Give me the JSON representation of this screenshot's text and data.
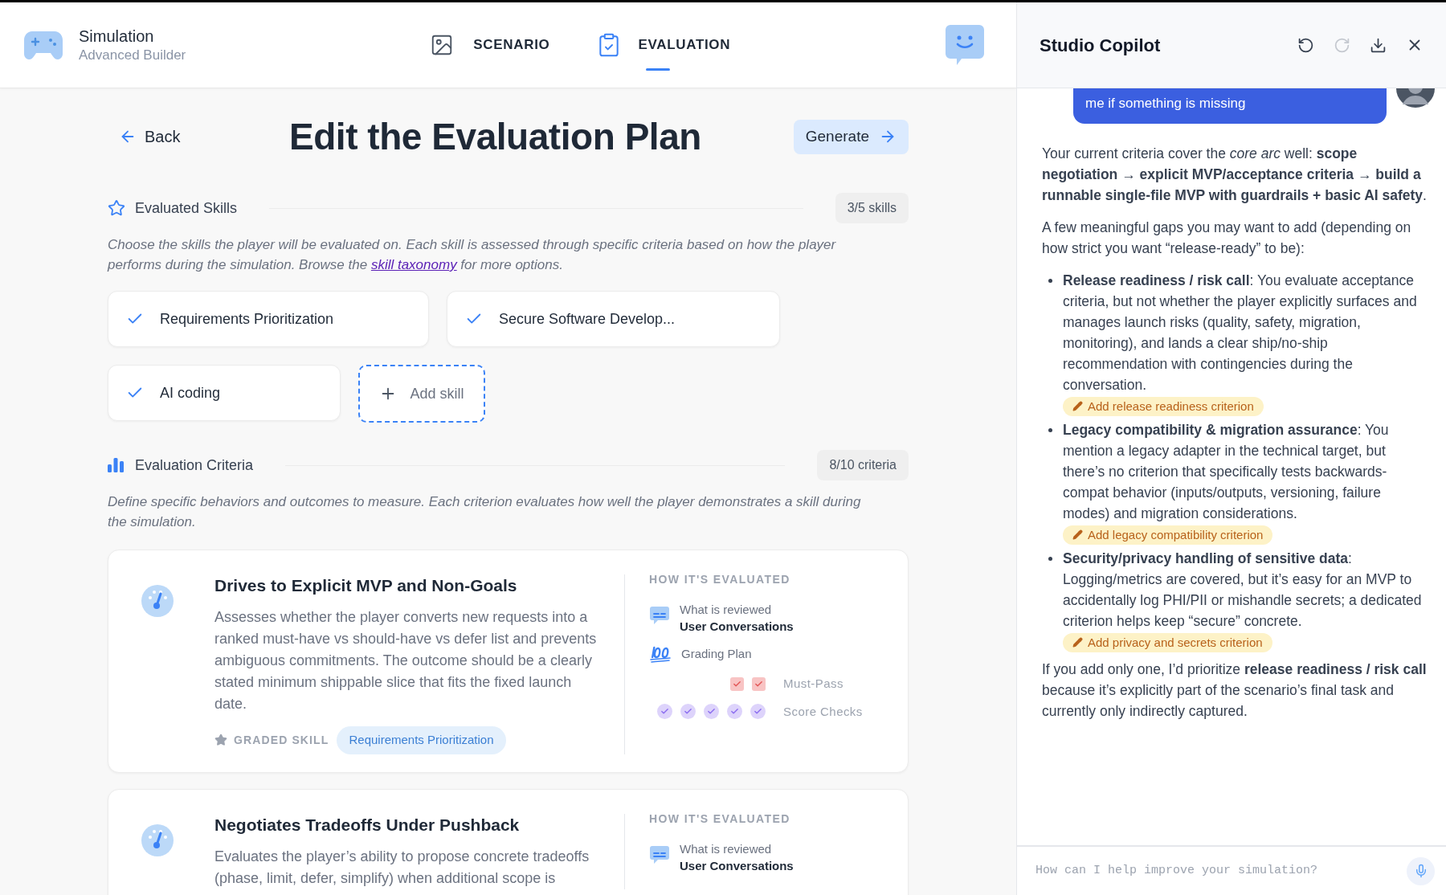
{
  "app": {
    "title": "Simulation",
    "subtitle": "Advanced Builder"
  },
  "tabs": [
    {
      "label": "SCENARIO",
      "kind": "scenario",
      "selected": false
    },
    {
      "label": "EVALUATION",
      "kind": "evaluation",
      "selected": true
    }
  ],
  "page": {
    "back": "Back",
    "title": "Edit the Evaluation Plan",
    "generate": "Generate"
  },
  "skills_section": {
    "title": "Evaluated Skills",
    "count": "3/5 skills",
    "description_before": "Choose the skills the player will be evaluated on. Each skill is assessed through specific criteria based on how the player performs during the simulation. Browse the ",
    "link": "skill taxonomy",
    "description_after": " for more options."
  },
  "skills": [
    {
      "label": "Requirements Prioritization",
      "checked": true
    },
    {
      "label": "Secure Software Develop...",
      "checked": true
    },
    {
      "label": "AI coding",
      "checked": true
    }
  ],
  "add_skill": "Add skill",
  "criteria_section": {
    "title": "Evaluation Criteria",
    "count": "8/10 criteria",
    "description": "Define specific behaviors and outcomes to measure. Each criterion evaluates how well the player demonstrates a skill during the simulation."
  },
  "criteria": [
    {
      "title": "Drives to Explicit MVP and Non-Goals",
      "description": "Assesses whether the player converts new requests into a ranked must-have vs should-have vs defer list and prevents ambiguous commitments. The outcome should be a clearly stated minimum shippable slice that fits the fixed launch date.",
      "graded_label": "GRADED SKILL",
      "skill": "Requirements Prioritization",
      "how_label": "HOW IT'S EVALUATED",
      "reviewed_label": "What is reviewed",
      "reviewed_value": "User Conversations",
      "grading_label": "Grading Plan",
      "must_pass_label": "Must-Pass",
      "must_pass": [
        {
          "checked": true
        },
        {
          "checked": true
        }
      ],
      "score_label": "Score Checks",
      "score_checks": [
        {
          "checked": true
        },
        {
          "checked": true
        },
        {
          "checked": true
        },
        {
          "checked": true
        },
        {
          "checked": true
        }
      ]
    },
    {
      "title": "Negotiates Tradeoffs Under Pushback",
      "description": "Evaluates the player’s ability to propose concrete tradeoffs (phase, limit, defer, simplify) when additional scope is",
      "how_label": "HOW IT'S EVALUATED",
      "reviewed_label": "What is reviewed",
      "reviewed_value": "User Conversations"
    }
  ],
  "copilot": {
    "title": "Studio Copilot",
    "user_message": "me if something is missing",
    "paragraphs_before": [
      "Your current criteria cover the *core arc* well: **scope negotiation → explicit MVP/acceptance criteria → build a runnable single-file MVP with guardrails + basic AI safety**.",
      "A few meaningful gaps you may want to add (depending on how strict you want “release-ready” to be):"
    ],
    "bullets": [
      {
        "text": "**Release readiness / risk call**: You evaluate acceptance criteria, but not whether the player explicitly surfaces and manages launch risks (quality, safety, migration, monitoring), and lands a clear ship/no-ship recommendation with contingencies during the conversation.",
        "action": "Add release readiness criterion"
      },
      {
        "text": "**Legacy compatibility & migration assurance**: You mention a legacy adapter in the technical target, but there’s no criterion that specifically tests backwards-compat behavior (inputs/outputs, versioning, failure modes) and migration considerations.",
        "action": "Add legacy compatibility criterion"
      },
      {
        "text": "**Security/privacy handling of sensitive data**: Logging/metrics are covered, but it’s easy for an MVP to accidentally log PHI/PII or mishandle secrets; a dedicated criterion helps keep “secure” concrete.",
        "action": "Add privacy and secrets criterion"
      }
    ],
    "paragraphs_after": [
      "If you add only one, I’d prioritize **release readiness / risk call** because it’s explicitly part of the scenario’s final task and currently only indirectly captured."
    ],
    "input_placeholder": "How can I help improve your simulation?"
  }
}
